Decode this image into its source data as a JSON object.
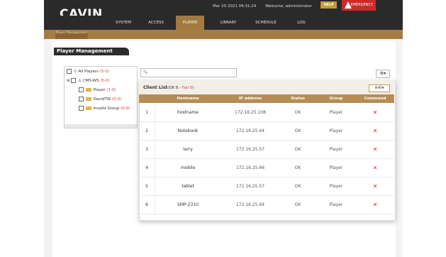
{
  "header": {
    "logo": "CAVIN",
    "datetime": "Mar 20 2021 04:31:24",
    "welcome": "Welcome, administrator",
    "help_label": "HELP",
    "emergency_label": "EMERGENCY"
  },
  "nav": {
    "tabs": [
      {
        "label": "SYSTEM"
      },
      {
        "label": "ACCESS"
      },
      {
        "label": "PLAYER"
      },
      {
        "label": "LIBRARY"
      },
      {
        "label": "SCHEDULE"
      },
      {
        "label": "LOG"
      }
    ],
    "subtab": "Player Management"
  },
  "panel": {
    "title": "Player Management"
  },
  "tree": {
    "items": [
      {
        "label": "All Players",
        "count": "(5-0)"
      },
      {
        "label": "CMS-WS",
        "count": "(5-0)"
      },
      {
        "label": "Player",
        "count": "(1-0)"
      },
      {
        "label": "DavidTW",
        "count": "(0-0)"
      },
      {
        "label": "Invalid Group",
        "count": "(0-0)"
      }
    ]
  },
  "client_list": {
    "title": "Client List",
    "ok_text": "(OK 6 - ",
    "fail_text": "Fail 0",
    "close_paren": ")",
    "all_button": "All",
    "columns": [
      "Hostname",
      "IP address",
      "Status",
      "Group",
      "Command"
    ],
    "rows": [
      {
        "index": "1",
        "hostname": "hostname",
        "ip": "172.16.25.108",
        "status": "OK",
        "group": "Player",
        "command": "✕"
      },
      {
        "index": "2",
        "hostname": "Notebook",
        "ip": "172.16.25.44",
        "status": "OK",
        "group": "Player",
        "command": "✕"
      },
      {
        "index": "3",
        "hostname": "larry",
        "ip": "172.16.25.57",
        "status": "OK",
        "group": "Player",
        "command": "✕"
      },
      {
        "index": "4",
        "hostname": "mobile",
        "ip": "172.16.25.66",
        "status": "OK",
        "group": "Player",
        "command": "✕"
      },
      {
        "index": "5",
        "hostname": "tablet",
        "ip": "172.16.25.57",
        "status": "OK",
        "group": "Player",
        "command": "✕"
      },
      {
        "index": "6",
        "hostname": "SMP-2310",
        "ip": "172.16.25.94",
        "status": "OK",
        "group": "Player",
        "command": "✕"
      }
    ]
  },
  "colors": {
    "brand_gold": "#a37b40",
    "dark": "#2a2a2a",
    "emergency_red": "#cc2a2a",
    "delete_red": "#d42c2c"
  }
}
